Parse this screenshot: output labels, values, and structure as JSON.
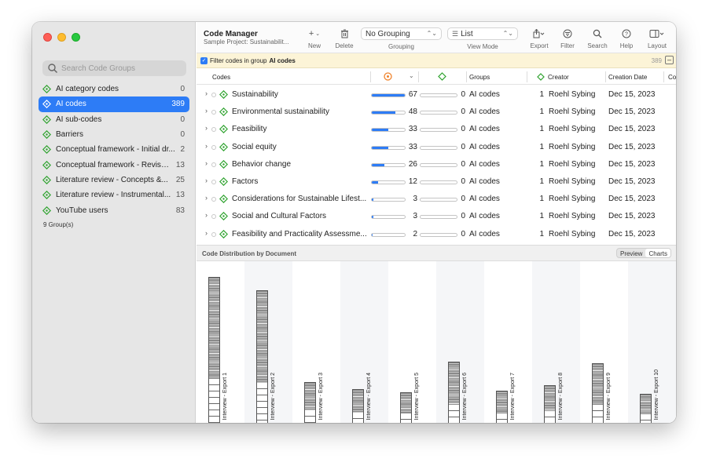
{
  "sidebar": {
    "search_placeholder": "Search Code Groups",
    "groups": [
      {
        "name": "AI category codes",
        "count": "0"
      },
      {
        "name": "AI codes",
        "count": "389",
        "selected": true
      },
      {
        "name": "AI sub-codes",
        "count": "0"
      },
      {
        "name": "Barriers",
        "count": "0"
      },
      {
        "name": "Conceptual framework - Initial dr...",
        "count": "2"
      },
      {
        "name": "Conceptual framework - Revise...",
        "count": "13"
      },
      {
        "name": "Literature review - Concepts &...",
        "count": "25"
      },
      {
        "name": "Literature review - Instrumental...",
        "count": "13"
      },
      {
        "name": "YouTube users",
        "count": "83"
      }
    ],
    "groups_count": "9 Group(s)"
  },
  "toolbar": {
    "title": "Code Manager",
    "subtitle": "Sample Project: Sustainabilit...",
    "new_label": "New",
    "delete_label": "Delete",
    "grouping_value": "No Grouping",
    "grouping_label": "Grouping",
    "viewmode_value": "List",
    "viewmode_label": "View Mode",
    "export_label": "Export",
    "filter_label": "Filter",
    "search_label": "Search",
    "help_label": "Help",
    "layout_label": "Layout"
  },
  "filterbar": {
    "text": "Filter codes in group",
    "group": "AI codes",
    "count": "389"
  },
  "table": {
    "headers": {
      "codes": "Codes",
      "groups": "Groups",
      "creator": "Creator",
      "creation_date": "Creation Date",
      "co": "Co"
    },
    "rows": [
      {
        "name": "Sustainability",
        "grounded": "67",
        "grounded_frac": 1.0,
        "density": "0",
        "group": "AI codes",
        "count": "1",
        "creator": "Roehl Sybing",
        "date": "Dec 15, 2023"
      },
      {
        "name": "Environmental sustainability",
        "grounded": "48",
        "grounded_frac": 0.72,
        "density": "0",
        "group": "AI codes",
        "count": "1",
        "creator": "Roehl Sybing",
        "date": "Dec 15, 2023"
      },
      {
        "name": "Feasibility",
        "grounded": "33",
        "grounded_frac": 0.5,
        "density": "0",
        "group": "AI codes",
        "count": "1",
        "creator": "Roehl Sybing",
        "date": "Dec 15, 2023"
      },
      {
        "name": "Social equity",
        "grounded": "33",
        "grounded_frac": 0.5,
        "density": "0",
        "group": "AI codes",
        "count": "1",
        "creator": "Roehl Sybing",
        "date": "Dec 15, 2023"
      },
      {
        "name": "Behavior change",
        "grounded": "26",
        "grounded_frac": 0.39,
        "density": "0",
        "group": "AI codes",
        "count": "1",
        "creator": "Roehl Sybing",
        "date": "Dec 15, 2023"
      },
      {
        "name": "Factors",
        "grounded": "12",
        "grounded_frac": 0.18,
        "density": "0",
        "group": "AI codes",
        "count": "1",
        "creator": "Roehl Sybing",
        "date": "Dec 15, 2023"
      },
      {
        "name": "Considerations for Sustainable Lifest...",
        "grounded": "3",
        "grounded_frac": 0.045,
        "density": "0",
        "group": "AI codes",
        "count": "1",
        "creator": "Roehl Sybing",
        "date": "Dec 15, 2023"
      },
      {
        "name": "Social and Cultural Factors",
        "grounded": "3",
        "grounded_frac": 0.045,
        "density": "0",
        "group": "AI codes",
        "count": "1",
        "creator": "Roehl Sybing",
        "date": "Dec 15, 2023"
      },
      {
        "name": "Feasibility and Practicality Assessme...",
        "grounded": "2",
        "grounded_frac": 0.03,
        "density": "0",
        "group": "AI codes",
        "count": "1",
        "creator": "Roehl Sybing",
        "date": "Dec 15, 2023"
      }
    ]
  },
  "distribution": {
    "title": "Code Distribution by Document",
    "preview_label": "Preview",
    "charts_label": "Charts",
    "documents": [
      {
        "label": "Interview - Export 1",
        "level": 1.0
      },
      {
        "label": "Interview - Export 2",
        "level": 0.91
      },
      {
        "label": "Interview - Export 3",
        "level": 0.28
      },
      {
        "label": "Interview - Export 4",
        "level": 0.23
      },
      {
        "label": "Interview - Export 5",
        "level": 0.21
      },
      {
        "label": "Interview - Export 6",
        "level": 0.42
      },
      {
        "label": "Interview - Export 7",
        "level": 0.22
      },
      {
        "label": "Interview - Export 8",
        "level": 0.26
      },
      {
        "label": "Interview - Export 9",
        "level": 0.41
      },
      {
        "label": "Interview - Export 10",
        "level": 0.2
      }
    ]
  }
}
